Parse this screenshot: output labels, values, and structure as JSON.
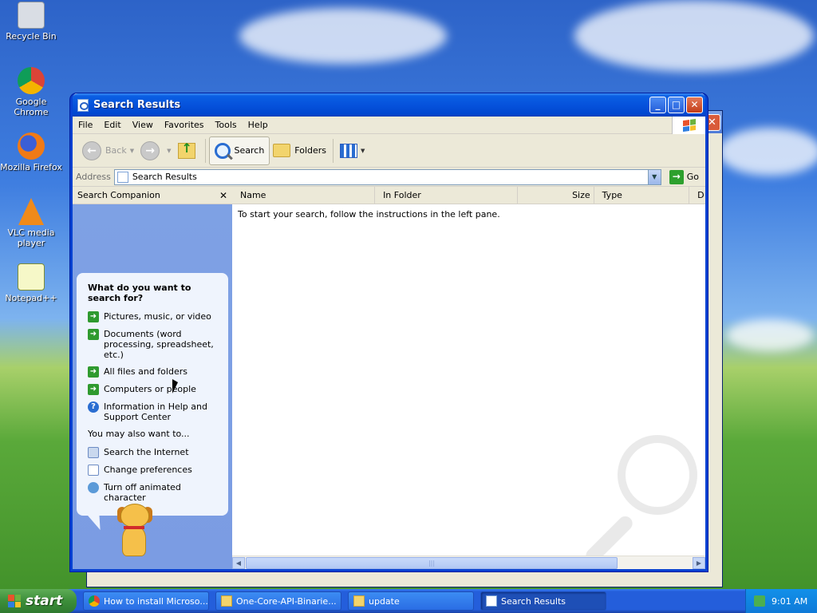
{
  "desktop": {
    "icons": [
      {
        "label": "Recycle Bin"
      },
      {
        "label": "Google Chrome"
      },
      {
        "label": "Mozilla Firefox"
      },
      {
        "label": "VLC media player"
      },
      {
        "label": "Notepad++"
      }
    ]
  },
  "window": {
    "title": "Search Results",
    "menu": [
      "File",
      "Edit",
      "View",
      "Favorites",
      "Tools",
      "Help"
    ],
    "toolbar": {
      "back_label": "Back",
      "search_label": "Search",
      "folders_label": "Folders"
    },
    "address": {
      "label": "Address",
      "value": "Search Results",
      "go_label": "Go"
    },
    "companion": {
      "title": "Search Companion",
      "question": "What do you want to search for?",
      "options": [
        "Pictures, music, or video",
        "Documents (word processing, spreadsheet, etc.)",
        "All files and folders",
        "Computers or people",
        "Information in Help and Support Center"
      ],
      "also_label": "You may also want to...",
      "also_options": [
        "Search the Internet",
        "Change preferences",
        "Turn off animated character"
      ]
    },
    "results": {
      "columns": [
        "Name",
        "In Folder",
        "Size",
        "Type",
        "D"
      ],
      "hint": "To start your search, follow the instructions in the left pane."
    }
  },
  "taskbar": {
    "start_label": "start",
    "tasks": [
      {
        "label": "How to install Microso..."
      },
      {
        "label": "One-Core-API-Binarie..."
      },
      {
        "label": "update"
      },
      {
        "label": "Search Results"
      }
    ],
    "clock": "9:01 AM"
  }
}
